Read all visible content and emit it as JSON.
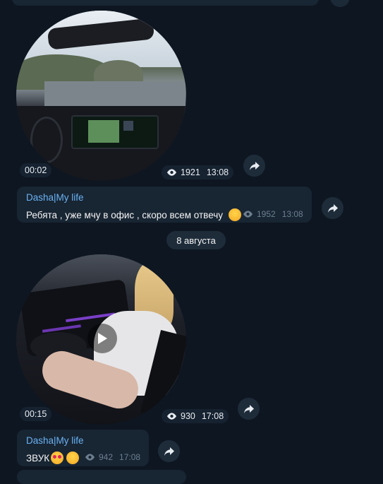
{
  "colors": {
    "background": "#0e1621",
    "bubble": "#182533",
    "author": "#6ab3f3",
    "meta": "#6d7f8f"
  },
  "video1": {
    "duration": "00:02",
    "views": "1921",
    "time": "13:08",
    "screen_label": "Dasha|My life"
  },
  "message1": {
    "author": "Dasha|My life",
    "text": "Ребята , уже мчу в офис , скоро всем отвечу",
    "emoji": "hugging-face",
    "views": "1952",
    "time": "13:08"
  },
  "date_separator": "8 августа",
  "video2": {
    "duration": "00:15",
    "views": "930",
    "time": "17:08",
    "play_icon": "play-icon"
  },
  "message2": {
    "author": "Dasha|My life",
    "text": "ЗВУК",
    "emojis": [
      "heart-eyes",
      "smiling-blush"
    ],
    "views": "942",
    "time": "17:08"
  },
  "icons": {
    "share": "share-arrow-icon",
    "views": "eye-icon"
  }
}
